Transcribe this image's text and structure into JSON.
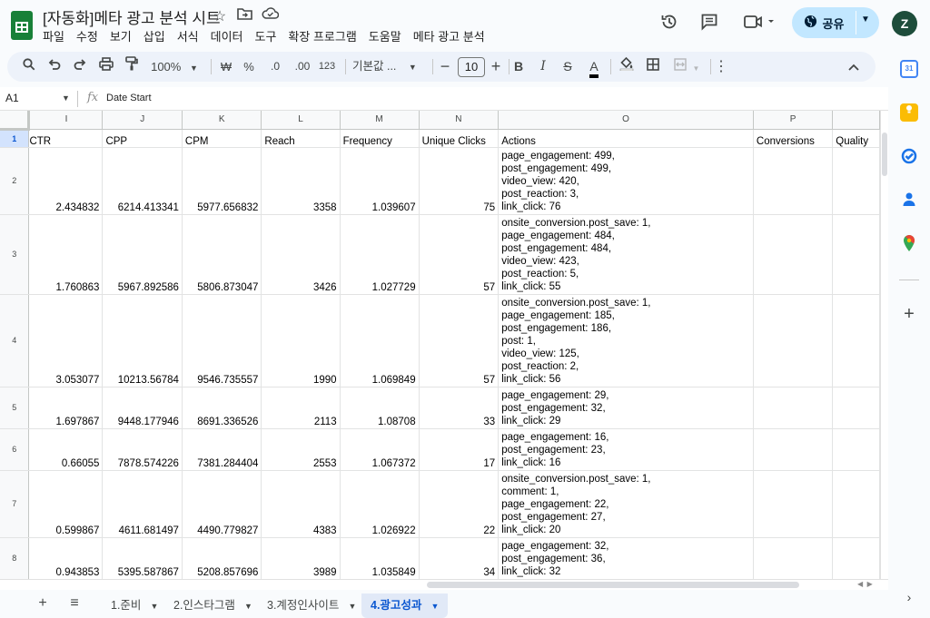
{
  "header": {
    "title": "[자동화]메타 광고 분석 시트",
    "menu": [
      "파일",
      "수정",
      "보기",
      "삽입",
      "서식",
      "데이터",
      "도구",
      "확장 프로그램",
      "도움말",
      "메타 광고 분석"
    ],
    "share_label": "공유",
    "avatar_letter": "Z"
  },
  "toolbar": {
    "zoom": "100%",
    "currency": "₩",
    "percent": "%",
    "dec_decrease": ".0",
    "dec_increase": ".00",
    "number_format": "123",
    "font_family": "기본값 ...",
    "font_size": "10"
  },
  "formula_bar": {
    "name_box": "A1",
    "fx": "fx",
    "value": "Date Start"
  },
  "grid": {
    "columns": [
      "I",
      "J",
      "K",
      "L",
      "M",
      "N",
      "O",
      "P",
      ""
    ],
    "headers": [
      "CTR",
      "CPP",
      "CPM",
      "Reach",
      "Frequency",
      "Unique Clicks",
      "Actions",
      "Conversions",
      "Quality"
    ],
    "rows": [
      {
        "num": "2",
        "ctr": "2.434832",
        "cpp": "6214.413341",
        "cpm": "5977.656832",
        "reach": "3358",
        "freq": "1.039607",
        "clicks": "75",
        "actions": "page_engagement: 499,\npost_engagement: 499,\nvideo_view: 420,\npost_reaction: 3,\nlink_click: 76"
      },
      {
        "num": "3",
        "ctr": "1.760863",
        "cpp": "5967.892586",
        "cpm": "5806.873047",
        "reach": "3426",
        "freq": "1.027729",
        "clicks": "57",
        "actions": "onsite_conversion.post_save: 1,\npage_engagement: 484,\npost_engagement: 484,\nvideo_view: 423,\npost_reaction: 5,\nlink_click: 55"
      },
      {
        "num": "4",
        "ctr": "3.053077",
        "cpp": "10213.56784",
        "cpm": "9546.735557",
        "reach": "1990",
        "freq": "1.069849",
        "clicks": "57",
        "actions": "onsite_conversion.post_save: 1,\npage_engagement: 185,\npost_engagement: 186,\npost: 1,\nvideo_view: 125,\npost_reaction: 2,\nlink_click: 56"
      },
      {
        "num": "5",
        "ctr": "1.697867",
        "cpp": "9448.177946",
        "cpm": "8691.336526",
        "reach": "2113",
        "freq": "1.08708",
        "clicks": "33",
        "actions": "page_engagement: 29,\npost_engagement: 32,\nlink_click: 29"
      },
      {
        "num": "6",
        "ctr": "0.66055",
        "cpp": "7878.574226",
        "cpm": "7381.284404",
        "reach": "2553",
        "freq": "1.067372",
        "clicks": "17",
        "actions": "page_engagement: 16,\npost_engagement: 23,\nlink_click: 16"
      },
      {
        "num": "7",
        "ctr": "0.599867",
        "cpp": "4611.681497",
        "cpm": "4490.779827",
        "reach": "4383",
        "freq": "1.026922",
        "clicks": "22",
        "actions": "onsite_conversion.post_save: 1,\ncomment: 1,\npage_engagement: 22,\npost_engagement: 27,\nlink_click: 20"
      },
      {
        "num": "8",
        "ctr": "0.943853",
        "cpp": "5395.587867",
        "cpm": "5208.857696",
        "reach": "3989",
        "freq": "1.035849",
        "clicks": "34",
        "actions": "page_engagement: 32,\npost_engagement: 36,\nlink_click: 32"
      }
    ]
  },
  "sheets": [
    {
      "label": "1.준비",
      "active": false
    },
    {
      "label": "2.인스타그램",
      "active": false
    },
    {
      "label": "3.계정인사이트",
      "active": false
    },
    {
      "label": "4.광고성과",
      "active": true
    }
  ],
  "side_panel": {
    "calendar_day": "31"
  }
}
